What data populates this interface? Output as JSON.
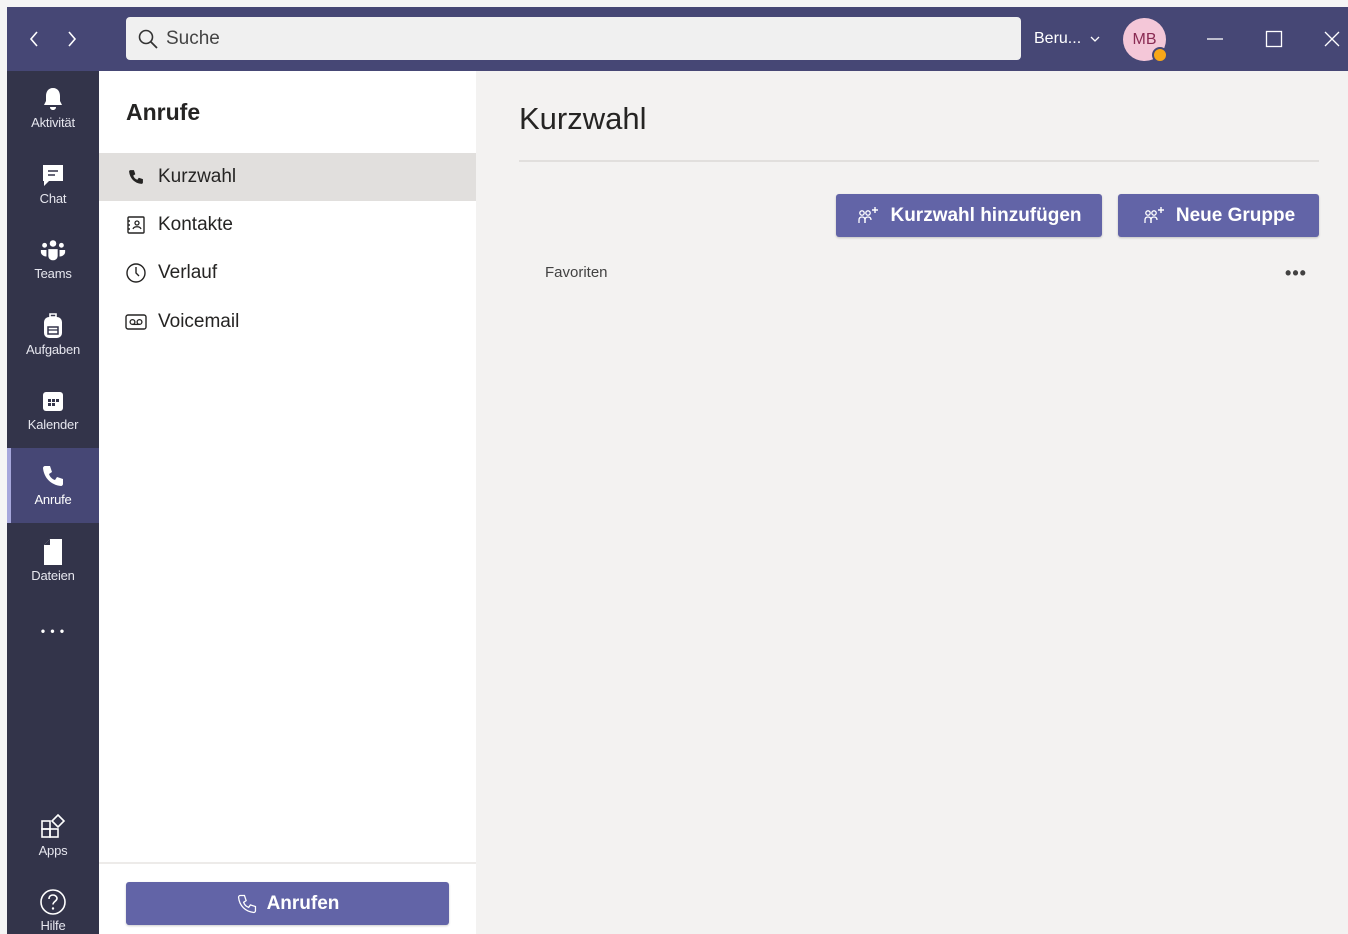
{
  "titlebar": {
    "search_placeholder": "Suche",
    "status_label": "Beru...",
    "avatar_initials": "MB",
    "back_icon": "chevron-left-icon",
    "forward_icon": "chevron-right-icon"
  },
  "appbar": {
    "items": [
      {
        "label": "Aktivität",
        "icon": "bell-icon"
      },
      {
        "label": "Chat",
        "icon": "chat-icon"
      },
      {
        "label": "Teams",
        "icon": "teams-icon"
      },
      {
        "label": "Aufgaben",
        "icon": "backpack-icon"
      },
      {
        "label": "Kalender",
        "icon": "calendar-icon"
      },
      {
        "label": "Anrufe",
        "icon": "phone-icon",
        "active": true
      },
      {
        "label": "Dateien",
        "icon": "file-icon"
      }
    ],
    "more_label": "• • •",
    "bottom_items": [
      {
        "label": "Apps",
        "icon": "apps-icon"
      },
      {
        "label": "Hilfe",
        "icon": "help-icon"
      }
    ]
  },
  "sidebar": {
    "title": "Anrufe",
    "items": [
      {
        "label": "Kurzwahl",
        "icon": "phone-icon",
        "active": true
      },
      {
        "label": "Kontakte",
        "icon": "contact-card-icon"
      },
      {
        "label": "Verlauf",
        "icon": "clock-icon"
      },
      {
        "label": "Voicemail",
        "icon": "voicemail-icon"
      }
    ],
    "call_button_label": "Anrufen"
  },
  "main": {
    "title": "Kurzwahl",
    "add_speed_dial_label": "Kurzwahl hinzufügen",
    "new_group_label": "Neue Gruppe",
    "favorites_label": "Favoriten",
    "more_label": "•••"
  },
  "colors": {
    "titlebar": "#464775",
    "appbar": "#33344a",
    "accent": "#6264a7",
    "background": "#f3f2f1"
  }
}
